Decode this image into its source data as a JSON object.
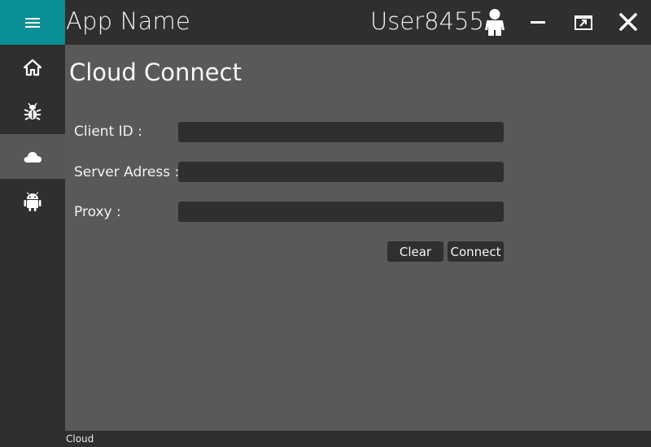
{
  "window": {
    "app_name": "App Name",
    "user_name": "User8455",
    "icons": {
      "menu": "hamburger-menu-icon",
      "user": "user-icon",
      "minimize": "minimize-icon",
      "restore": "restore-icon",
      "close": "close-icon"
    }
  },
  "sidebar": {
    "accent_color": "#0a8f95",
    "items": [
      {
        "icon": "home-icon",
        "active": false
      },
      {
        "icon": "bug-icon",
        "active": false
      },
      {
        "icon": "cloud-icon",
        "active": true
      },
      {
        "icon": "android-icon",
        "active": false
      }
    ]
  },
  "page": {
    "title": "Cloud Connect"
  },
  "form": {
    "client_id": {
      "label": "Client ID :",
      "value": "",
      "placeholder": ""
    },
    "server_address": {
      "label": "Server Adress :",
      "value": "",
      "placeholder": ""
    },
    "proxy": {
      "label": "Proxy :",
      "value": "",
      "placeholder": ""
    },
    "clear_label": "Clear",
    "connect_label": "Connect"
  },
  "status": {
    "text": "Cloud"
  }
}
